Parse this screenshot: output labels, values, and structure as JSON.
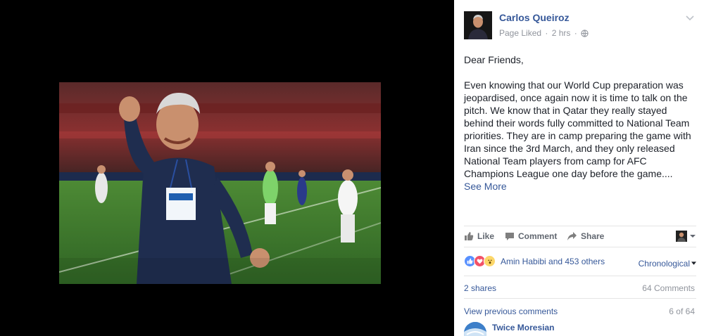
{
  "post": {
    "author": "Carlos Queiroz",
    "page_status": "Page Liked",
    "time": "2 hrs",
    "greeting": "Dear Friends,",
    "text": "Even knowing that our World Cup preparation was jeopardised, once again now it is time to talk on the pitch. We know that in Qatar they really stayed behind their words fully committed to National Team priorities. They are in camp preparing the game with Iran since the 3rd March, and they only released National Team players from camp for AFC Champions League one day before the game....",
    "see_more": "See More"
  },
  "actions": {
    "like": "Like",
    "comment": "Comment",
    "share": "Share"
  },
  "reactions": {
    "summary": "Amin Habibi and 453 others",
    "types": [
      "like-icon",
      "love-icon",
      "wow-icon"
    ],
    "sort_label": "Chronological"
  },
  "stats": {
    "shares": "2 shares",
    "comments": "64 Comments"
  },
  "comments_section": {
    "view_previous": "View previous comments",
    "count": "6 of 64",
    "first_commenter": "Twice Moresian"
  },
  "colors": {
    "link": "#365899",
    "muted": "#90949c",
    "action": "#616770",
    "viewer_bg": "#000000",
    "pitch": "#3f7a2e"
  }
}
